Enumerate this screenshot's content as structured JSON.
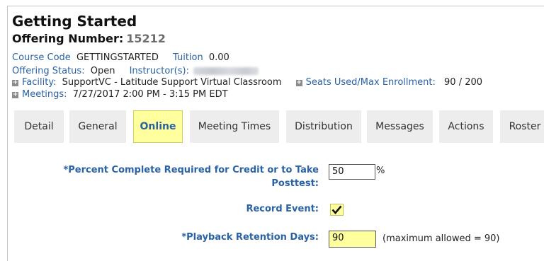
{
  "header": {
    "title": "Getting Started",
    "offering_label": "Offering Number:",
    "offering_number": "15212"
  },
  "info": {
    "course_code_label": "Course Code",
    "course_code": "GETTINGSTARTED",
    "tuition_label": "Tuition",
    "tuition": "0.00",
    "status_label": "Offering Status:",
    "status": "Open",
    "instructor_label": "Instructor(s):",
    "facility_label": "Facility:",
    "facility": "SupportVC - Latitude Support Virtual Classroom",
    "seats_label": "Seats Used/Max Enrollment:",
    "seats_used": "90",
    "seats_sep": "/",
    "seats_max": "200",
    "meetings_label": "Meetings:",
    "meetings": "7/27/2017 2:00 PM - 3:15 PM EDT",
    "expand_glyph": "+"
  },
  "tabs": [
    {
      "label": "Detail"
    },
    {
      "label": "General"
    },
    {
      "label": "Online"
    },
    {
      "label": "Meeting Times"
    },
    {
      "label": "Distribution"
    },
    {
      "label": "Messages"
    },
    {
      "label": "Actions"
    },
    {
      "label": "Roster"
    }
  ],
  "form": {
    "percent_label_line1": "*Percent Complete Required for Credit or to Take",
    "percent_label_line2": "Posttest:",
    "percent_value": "50",
    "percent_unit": "%",
    "record_label": "Record Event:",
    "record_checked": true,
    "retention_label": "*Playback Retention Days:",
    "retention_value": "90",
    "retention_note": "(maximum allowed = 90)"
  },
  "colors": {
    "label_blue": "#2a62a6",
    "highlight_yellow": "#ffff9e",
    "tab_gray": "#ededed"
  }
}
